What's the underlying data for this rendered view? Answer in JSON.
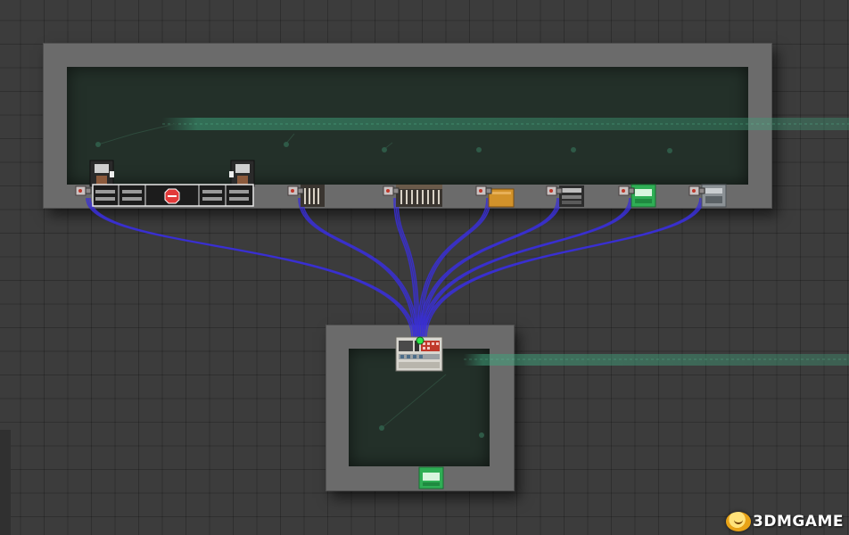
{
  "scene": {
    "colors": {
      "floor": "#3c3c3c",
      "wall": "#6b6b6b",
      "interior": "#233029",
      "wire": "#3a2fd6",
      "gas_trail": "#2f7a5a",
      "hub_light": "#2ee84a"
    },
    "devices": [
      {
        "name": "vending-machine-left",
        "icon": "vending-machine-icon"
      },
      {
        "name": "vending-machine-right",
        "icon": "vending-machine-icon"
      },
      {
        "name": "counter-with-stop-sign",
        "icon": "stop-sign-icon"
      },
      {
        "name": "grill-station",
        "icon": "grill-icon"
      },
      {
        "name": "wide-grill-station",
        "icon": "grill-icon"
      },
      {
        "name": "orange-crate",
        "icon": "crate-icon"
      },
      {
        "name": "machine-console",
        "icon": "console-icon"
      },
      {
        "name": "green-terminal",
        "icon": "terminal-icon"
      },
      {
        "name": "gray-terminal",
        "icon": "terminal-icon"
      },
      {
        "name": "control-hub",
        "icon": "control-panel-icon"
      },
      {
        "name": "green-door-terminal",
        "icon": "terminal-icon"
      }
    ]
  },
  "watermark": {
    "text": "3DMGAME",
    "icon": "mascot-face-icon"
  }
}
